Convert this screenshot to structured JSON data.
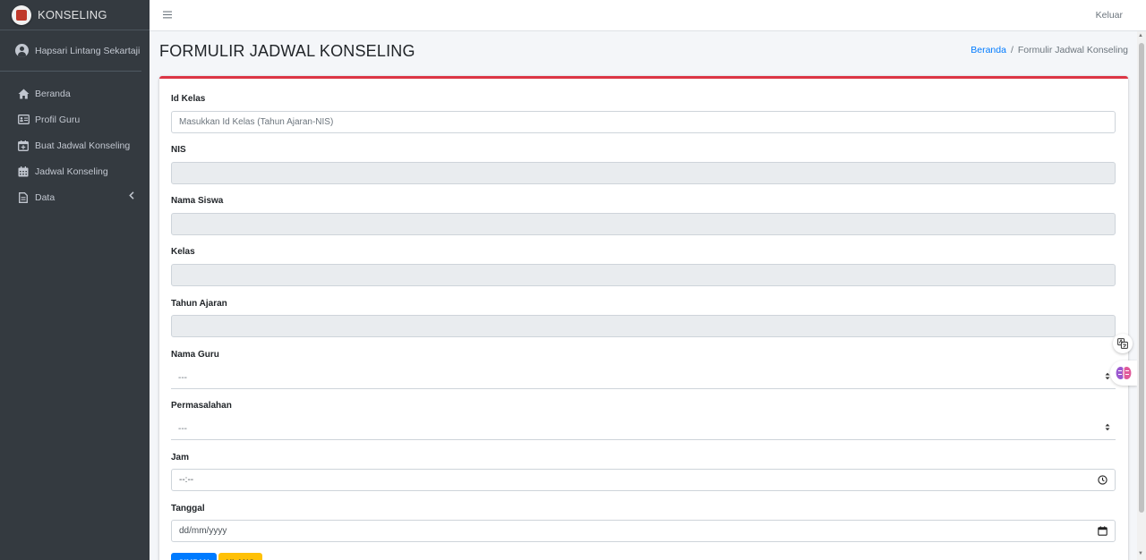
{
  "brand": {
    "name": "KONSELING"
  },
  "user": {
    "name": "Hapsari Lintang Sekartaji"
  },
  "sidebar": {
    "items": [
      {
        "label": "Beranda",
        "icon": "home-icon"
      },
      {
        "label": "Profil Guru",
        "icon": "id-card-icon"
      },
      {
        "label": "Buat Jadwal Konseling",
        "icon": "calendar-plus-icon"
      },
      {
        "label": "Jadwal Konseling",
        "icon": "calendar-icon"
      },
      {
        "label": "Data",
        "icon": "file-icon",
        "has_chevron": true
      }
    ]
  },
  "topbar": {
    "menu_icon": "hamburger-icon",
    "logout_label": "Keluar"
  },
  "header": {
    "title": "FORMULIR JADWAL KONSELING",
    "breadcrumb": {
      "home": "Beranda",
      "separator": "/",
      "current": "Formulir Jadwal Konseling"
    }
  },
  "form": {
    "id_kelas": {
      "label": "Id Kelas",
      "placeholder": "Masukkan Id Kelas (Tahun Ajaran-NIS)"
    },
    "nis": {
      "label": "NIS"
    },
    "nama_siswa": {
      "label": "Nama Siswa"
    },
    "kelas": {
      "label": "Kelas"
    },
    "tahun_ajaran": {
      "label": "Tahun Ajaran"
    },
    "nama_guru": {
      "label": "Nama Guru",
      "value": "---"
    },
    "permasalahan": {
      "label": "Permasalahan",
      "value": "---"
    },
    "jam": {
      "label": "Jam",
      "value": "--:--"
    },
    "tanggal": {
      "label": "Tanggal",
      "value": "dd/mm/yyyy"
    },
    "buttons": {
      "submit": "SIMPAN",
      "reset": "ULANG"
    }
  },
  "colors": {
    "sidebar": "#343a40",
    "accent_top": "#dc3545",
    "primary": "#007bff",
    "warning": "#ffc107"
  }
}
